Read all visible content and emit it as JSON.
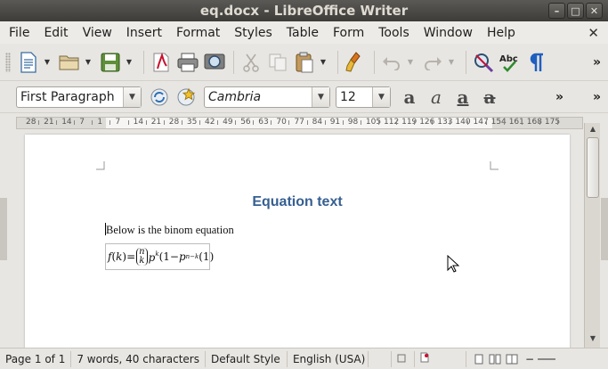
{
  "window": {
    "title": "eq.docx - LibreOffice Writer"
  },
  "menu": {
    "items": [
      "File",
      "Edit",
      "View",
      "Insert",
      "Format",
      "Styles",
      "Table",
      "Form",
      "Tools",
      "Window",
      "Help"
    ]
  },
  "format_bar": {
    "paragraph_style": "First Paragraph",
    "font_name": "Cambria",
    "font_size": "12"
  },
  "ruler": {
    "labels": [
      "28",
      "21",
      "14",
      "7",
      "1",
      "7",
      "14",
      "21",
      "28",
      "35",
      "42",
      "49",
      "56",
      "63",
      "70",
      "77",
      "84",
      "91",
      "98",
      "105",
      "112",
      "119",
      "126",
      "133",
      "140",
      "147",
      "154",
      "161",
      "168",
      "175"
    ]
  },
  "document": {
    "heading": "Equation text",
    "paragraph": "Below is the binom equation"
  },
  "status": {
    "page": "Page 1 of 1",
    "words": "7 words, 40 characters",
    "style": "Default Style",
    "language": "English (USA)"
  },
  "colors": {
    "heading": "#365f91",
    "titlebar": "#3d3c39"
  }
}
